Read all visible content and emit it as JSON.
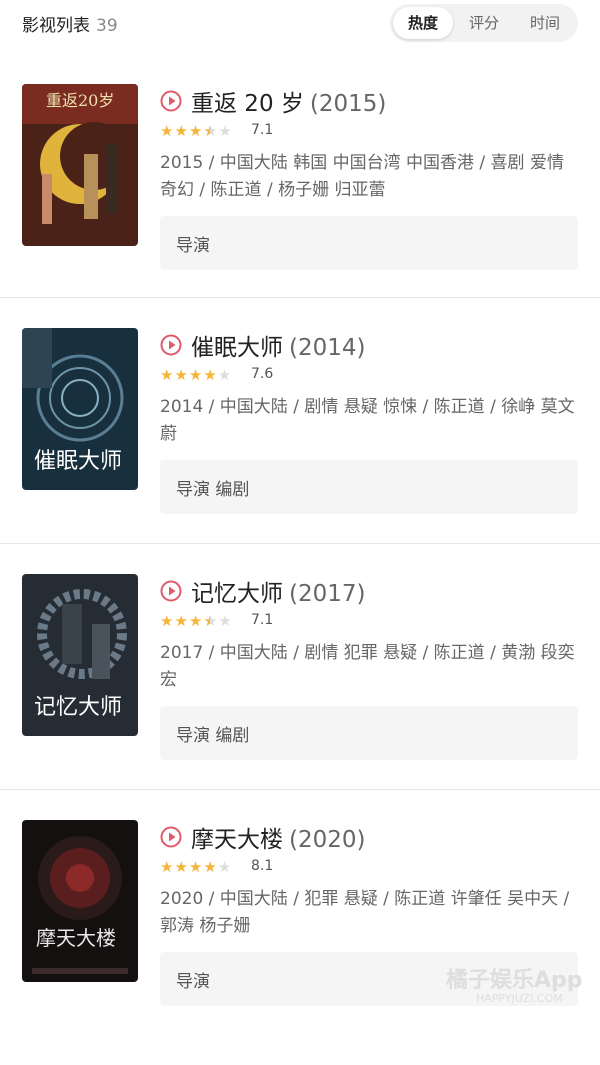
{
  "header": {
    "title": "影视列表",
    "count": "39",
    "sort_tabs": [
      {
        "label": "热度",
        "active": true
      },
      {
        "label": "评分",
        "active": false
      },
      {
        "label": "时间",
        "active": false
      }
    ]
  },
  "movies": [
    {
      "title": "重返 20 岁",
      "year": "(2015)",
      "stars": 3.5,
      "rating": "7.1",
      "meta": "2015 / 中国大陆 韩国 中国台湾 中国香港 / 喜剧 爱情 奇幻 / 陈正道 / 杨子姗 归亚蕾",
      "roles": "导演",
      "poster_colors": {
        "bg": "#5a2a1c",
        "accent": "#e0b43c"
      }
    },
    {
      "title": "催眠大师",
      "year": "(2014)",
      "stars": 4,
      "rating": "7.6",
      "meta": "2014 / 中国大陆 / 剧情 悬疑 惊悚 / 陈正道 / 徐峥 莫文蔚",
      "roles": "导演 编剧",
      "poster_colors": {
        "bg": "#1f3a4a",
        "accent": "#7aa0b8"
      }
    },
    {
      "title": "记忆大师",
      "year": "(2017)",
      "stars": 3.5,
      "rating": "7.1",
      "meta": "2017 / 中国大陆 / 剧情 犯罪 悬疑 / 陈正道 / 黄渤 段奕宏",
      "roles": "导演 编剧",
      "poster_colors": {
        "bg": "#2a3038",
        "accent": "#8a9aa8"
      }
    },
    {
      "title": "摩天大楼",
      "year": "(2020)",
      "stars": 4,
      "rating": "8.1",
      "meta": "2020 / 中国大陆 / 犯罪 悬疑 / 陈正道 许肇任 吴中天 / 郭涛 杨子姗",
      "roles": "导演",
      "poster_colors": {
        "bg": "#1a1414",
        "accent": "#8c2a2a"
      }
    }
  ],
  "watermark": {
    "main": "橘子娱乐App",
    "sub": "HAPPYJUZI.COM"
  },
  "colors": {
    "star": "#f5b53b",
    "play": "#e05a6a"
  }
}
